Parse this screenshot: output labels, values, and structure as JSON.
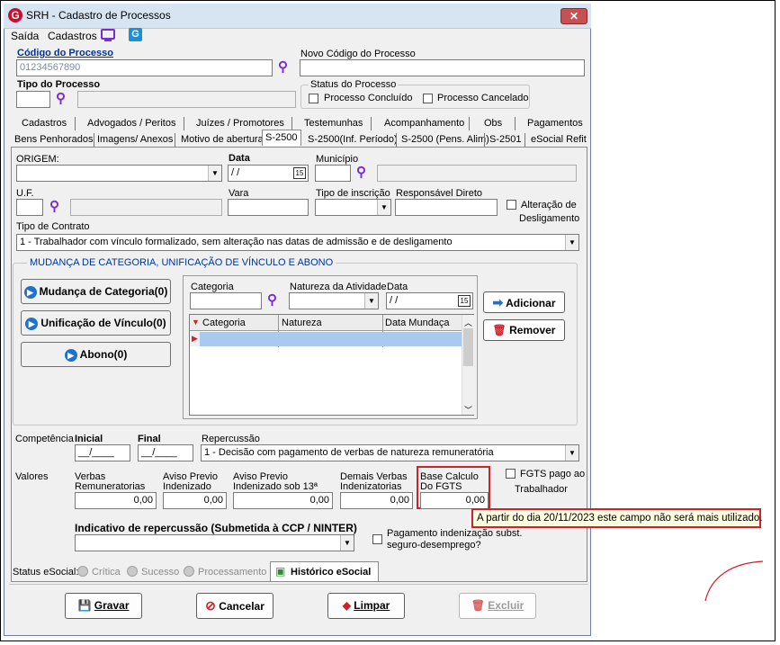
{
  "window": {
    "title": "SRH - Cadastro de Processos",
    "close": "✕"
  },
  "menu": {
    "saida": "Saída",
    "cadastros": "Cadastros"
  },
  "codigo": {
    "label": "Código do Processo",
    "value": "01234567890",
    "novo_label": "Novo Código do Processo"
  },
  "tipo": {
    "label": "Tipo do Processo"
  },
  "status_processo": {
    "title": "Status do Processo",
    "concluido": "Processo Concluído",
    "cancelado": "Processo Cancelado"
  },
  "tabs_row1": [
    "Cadastros",
    "Advogados / Peritos",
    "Juízes / Promotores",
    "Testemunhas",
    "Acompanhamento",
    "Obs",
    "Pagamentos"
  ],
  "tabs_row2": [
    "Bens Penhorados",
    "Imagens/ Anexos",
    "Motivo de abertura",
    "S-2500",
    "S-2500(Inf. Período)",
    "S-2500 (Pens. Alim)",
    "S-2501",
    "eSocial Refit"
  ],
  "form": {
    "origem": "ORIGEM:",
    "data": "Data",
    "data_value": "/ /",
    "municipio": "Município",
    "uf": "U.F.",
    "vara": "Vara",
    "tipo_inscricao": "Tipo de inscrição",
    "responsavel": "Responsável Direto",
    "alteracao": "Alteração de",
    "desligamento": "Desligamento",
    "tipo_contrato": "Tipo de Contrato",
    "tipo_contrato_value": "1 - Trabalhador com vínculo formalizado, sem alteração nas datas de admissão e de desligamento",
    "cal_icon": "15"
  },
  "mudanca": {
    "title": "MUDANÇA DE CATEGORIA, UNIFICAÇÃO DE VÍNCULO E ABONO",
    "btn_mudanca": "Mudança de Categoria(0)",
    "btn_unificacao": "Unificação de Vínculo(0)",
    "btn_abono": "Abono(0)",
    "categoria": "Categoria",
    "natureza": "Natureza da Atividade",
    "data": "Data",
    "data_value": "/ /",
    "btn_adicionar": "Adicionar",
    "btn_remover": "Remover",
    "grid_headers": [
      "Categoria",
      "Natureza",
      "Data Mundaça"
    ]
  },
  "competencia": {
    "label": "Competência",
    "inicial": "Inicial",
    "final": "Final",
    "inicial_value": "__/____",
    "final_value": "__/____",
    "repercussao": "Repercussão",
    "repercussao_value": "1 - Decisão com pagamento de verbas de natureza remuneratória"
  },
  "valores": {
    "label": "Valores",
    "verbas": [
      "Verbas",
      "Remuneratorias"
    ],
    "aviso": [
      "Aviso Previo",
      "Indenizado"
    ],
    "aviso13": [
      "Aviso Previo",
      "Indenizado sob 13ª"
    ],
    "demais": [
      "Demais Verbas",
      "Indenizatorias"
    ],
    "base": [
      "Base Calculo",
      "Do FGTS"
    ],
    "fgts_pago": "FGTS pago ao",
    "trabalhador": "Trabalhador",
    "zero": "0,00",
    "tooltip": "A partir do dia 20/11/2023 este campo não será mais utilizado."
  },
  "indicativo": {
    "label": "Indicativo de repercussão (Submetida à CCP / NINTER)",
    "pagamento": "Pagamento indenização subst.",
    "seguro": "seguro-desemprego?"
  },
  "status_esocial": {
    "label": "Status eSocial:",
    "critica": "Crítica",
    "sucesso": "Sucesso",
    "processamento": "Processamento",
    "historico": "Histórico eSocial"
  },
  "footer": {
    "gravar": "Gravar",
    "cancelar": "Cancelar",
    "limpar": "Limpar",
    "excluir": "Excluir"
  },
  "colors": {
    "accent_red": "#d0202a",
    "link_blue": "#003399",
    "icon_purple": "#7b2bd6",
    "title_bg": "#d7e4f2"
  }
}
